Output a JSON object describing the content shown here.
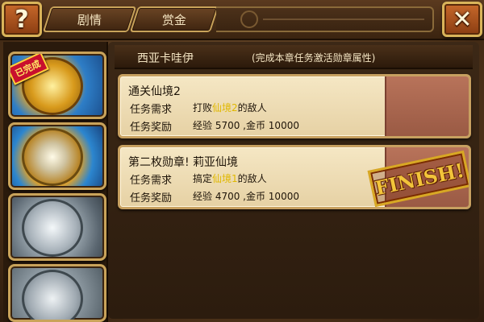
{
  "topbar": {
    "help_label": "?",
    "close_label": "✕",
    "tabs": [
      {
        "label": "剧情"
      },
      {
        "label": "赏金"
      }
    ]
  },
  "medals": [
    {
      "icon": "golden-warrior-medal-icon",
      "badge": "已完成"
    },
    {
      "icon": "skull-medal-icon"
    },
    {
      "icon": "silver-medal-icon"
    },
    {
      "icon": "silver-beast-medal-icon"
    }
  ],
  "panel": {
    "medal_name": "西亚卡哇伊",
    "hint": "(完成本章任务激活勋章属性)"
  },
  "tasks": [
    {
      "title": "通关仙境2",
      "req_label": "任务需求",
      "req_prefix": "打败",
      "req_highlight": "仙境2",
      "req_suffix": "的敌人",
      "reward_label": "任务奖励",
      "reward": "经验 5700 ,金币 10000",
      "stamp": ""
    },
    {
      "title": "第二枚勋章! 莉亚仙境",
      "req_label": "任务需求",
      "req_prefix": "搞定",
      "req_highlight": "仙境1",
      "req_suffix": "的敌人",
      "reward_label": "任务奖励",
      "reward": "经验 4700 ,金币 10000",
      "stamp": "FINISH!"
    }
  ],
  "colors": {
    "accent_gold": "#c9a35a",
    "card_bg": "#f5e7c4",
    "highlight": "#e0b800",
    "done_badge": "#c8102e"
  }
}
